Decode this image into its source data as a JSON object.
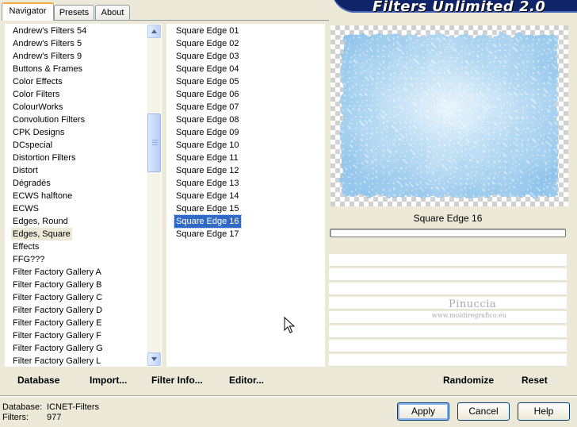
{
  "banner": {
    "title": "Filters Unlimited 2.0"
  },
  "tabs": [
    {
      "label": "Navigator",
      "active": true
    },
    {
      "label": "Presets",
      "active": false
    },
    {
      "label": "About",
      "active": false
    }
  ],
  "categories": {
    "items": [
      "Andrew's Filters 54",
      "Andrew's Filters 5",
      "Andrew's Filters 9",
      "Buttons & Frames",
      "Color Effects",
      "Color Filters",
      "ColourWorks",
      "Convolution Filters",
      "CPK Designs",
      "DCspecial",
      "Distortion Filters",
      "Distort",
      "Dégradés",
      "ECWS halftone",
      "ECWS",
      "Edges, Round",
      "Edges, Square",
      "Effects",
      "FFG???",
      "Filter Factory Gallery A",
      "Filter Factory Gallery B",
      "Filter Factory Gallery C",
      "Filter Factory Gallery D",
      "Filter Factory Gallery E",
      "Filter Factory Gallery F",
      "Filter Factory Gallery G",
      "Filter Factory Gallery L"
    ],
    "selected": "Edges, Square"
  },
  "filters": {
    "items": [
      "Square Edge 01",
      "Square Edge 02",
      "Square Edge 03",
      "Square Edge 04",
      "Square Edge 05",
      "Square Edge 06",
      "Square Edge 07",
      "Square Edge 08",
      "Square Edge 09",
      "Square Edge 10",
      "Square Edge 11",
      "Square Edge 12",
      "Square Edge 13",
      "Square Edge 14",
      "Square Edge 15",
      "Square Edge 16",
      "Square Edge 17"
    ],
    "selected": "Square Edge 16"
  },
  "preview": {
    "filter_name": "Square Edge 16",
    "watermark_name": "Pinuccia",
    "watermark_url": "www.moidiregrafico.eu"
  },
  "left_toolbar": {
    "database_label": "Database",
    "import_label": "Import...",
    "filter_info_label": "Filter Info...",
    "editor_label": "Editor..."
  },
  "right_toolbar": {
    "randomize_label": "Randomize",
    "reset_label": "Reset"
  },
  "status": {
    "database_label": "Database:",
    "database_value": "ICNET-Filters",
    "filters_label": "Filters:",
    "filters_value": "977"
  },
  "buttons": {
    "apply_label": "Apply",
    "cancel_label": "Cancel",
    "help_label": "Help"
  },
  "colors": {
    "selection_active": "#316ac5",
    "selection_inactive": "#ece9d8",
    "banner_bg": "#10246a",
    "dialog_bg": "#ece9d8"
  },
  "icons": {
    "scroll_up": "triangle-up-icon",
    "scroll_down": "triangle-down-icon",
    "mouse_pointer": "arrow-cursor-icon"
  }
}
